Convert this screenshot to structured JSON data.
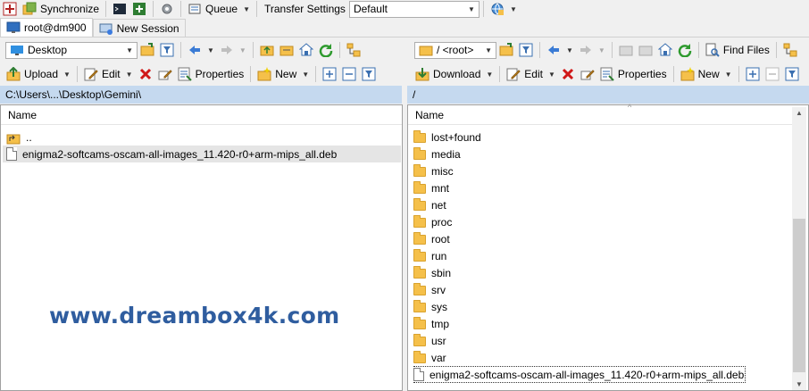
{
  "toolbar_top": {
    "synchronize": "Synchronize",
    "queue": "Queue",
    "transfer_settings_label": "Transfer Settings",
    "transfer_settings_value": "Default"
  },
  "tabs": [
    {
      "label": "root@dm900"
    },
    {
      "label": "New Session"
    }
  ],
  "left": {
    "location": "Desktop",
    "actions": {
      "upload": "Upload",
      "edit": "Edit",
      "properties": "Properties",
      "new": "New"
    },
    "path": "C:\\Users\\...\\Desktop\\Gemini\\",
    "column_name": "Name",
    "items": [
      {
        "name": "..",
        "kind": "up"
      },
      {
        "name": "enigma2-softcams-oscam-all-images_11.420-r0+arm-mips_all.deb",
        "kind": "file"
      }
    ]
  },
  "right": {
    "location": "/ <root>",
    "find_files": "Find Files",
    "actions": {
      "download": "Download",
      "edit": "Edit",
      "properties": "Properties",
      "new": "New"
    },
    "path": "/",
    "column_name": "Name",
    "items": [
      {
        "name": "lost+found",
        "kind": "folder"
      },
      {
        "name": "media",
        "kind": "folder"
      },
      {
        "name": "misc",
        "kind": "folder"
      },
      {
        "name": "mnt",
        "kind": "folder"
      },
      {
        "name": "net",
        "kind": "folder"
      },
      {
        "name": "proc",
        "kind": "folder"
      },
      {
        "name": "root",
        "kind": "folder"
      },
      {
        "name": "run",
        "kind": "folder"
      },
      {
        "name": "sbin",
        "kind": "folder"
      },
      {
        "name": "srv",
        "kind": "folder"
      },
      {
        "name": "sys",
        "kind": "folder"
      },
      {
        "name": "tmp",
        "kind": "folder"
      },
      {
        "name": "usr",
        "kind": "folder"
      },
      {
        "name": "var",
        "kind": "folder"
      },
      {
        "name": "enigma2-softcams-oscam-all-images_11.420-r0+arm-mips_all.deb",
        "kind": "file"
      }
    ]
  },
  "watermark": "www.dreambox4k.com",
  "colors": {
    "path_bar": "#c5d9ef",
    "folder": "#f5c04a",
    "watermark": "#2f5d9f"
  }
}
